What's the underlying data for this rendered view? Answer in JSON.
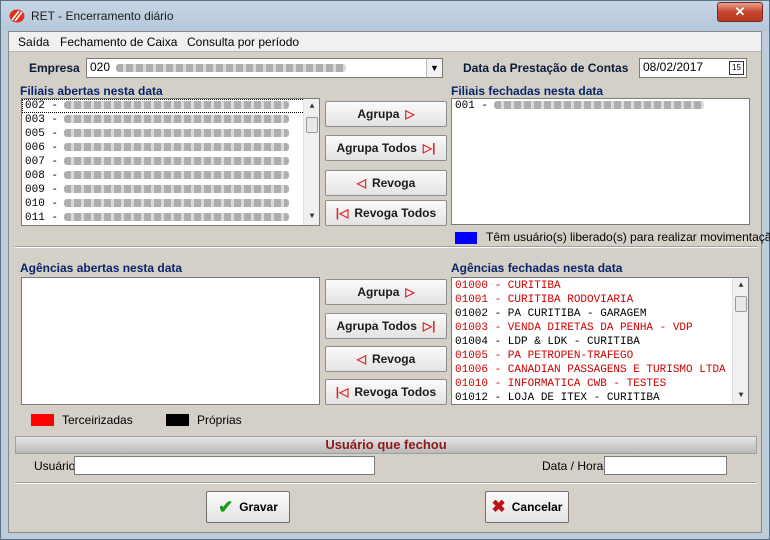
{
  "window": {
    "title": "RET - Encerramento diário",
    "close_label": "✕"
  },
  "menu": [
    "Saída",
    "Fechamento de Caixa",
    "Consulta por período"
  ],
  "empresa": {
    "label": "Empresa",
    "value": "020"
  },
  "data_prestacao": {
    "label": "Data da Prestação de Contas",
    "value": "08/02/2017",
    "icon": "calendar-icon"
  },
  "filiais_abertas": {
    "label": "Filiais abertas nesta data",
    "items": [
      "002 -",
      "003 -",
      "005 -",
      "006 -",
      "007 -",
      "008 -",
      "009 -",
      "010 -",
      "011 -"
    ]
  },
  "filiais_fechadas": {
    "label": "Filiais fechadas nesta data",
    "items": [
      "001 -"
    ]
  },
  "buttons_top": {
    "agrupa": "Agrupa",
    "agrupa_todos": "Agrupa Todos",
    "revoga": "Revoga",
    "revoga_todos": "Revoga Todos"
  },
  "legend_top": {
    "text": "Têm usuário(s) liberado(s) para realizar movimentação",
    "color": "#0000ff"
  },
  "agencias_abertas": {
    "label": "Agências abertas nesta data",
    "items": []
  },
  "agencias_fechadas": {
    "label": "Agências fechadas nesta data",
    "items": [
      {
        "text": "01000 - CURITIBA",
        "red": true
      },
      {
        "text": "01001 - CURITIBA RODOVIARIA",
        "red": true
      },
      {
        "text": "01002 - PA  CURITIBA - GARAGEM",
        "red": false
      },
      {
        "text": "01003 - VENDA DIRETAS DA PENHA - VDP",
        "red": true
      },
      {
        "text": "01004 - LDP & LDK - CURITIBA",
        "red": false
      },
      {
        "text": "01005 - PA PETROPEN-TRAFEGO",
        "red": true
      },
      {
        "text": "01006 - CANADIAN PASSAGENS E TURISMO LTDA",
        "red": true
      },
      {
        "text": "01010 - INFORMATICA CWB - TESTES",
        "red": true
      },
      {
        "text": "01012 - LOJA DE ITEX - CURITIBA",
        "red": false
      }
    ]
  },
  "buttons_bottom": {
    "agrupa": "Agrupa",
    "agrupa_todos": "Agrupa Todos",
    "revoga": "Revoga",
    "revoga_todos": "Revoga Todos"
  },
  "legend_bottom": [
    {
      "text": "Terceirizadas",
      "color": "#ff0000"
    },
    {
      "text": "Próprias",
      "color": "#000000"
    }
  ],
  "usuario_section": {
    "header": "Usuário que fechou",
    "usuario_label": "Usuário",
    "usuario_value": "",
    "datahora_label": "Data / Hora",
    "datahora_value": ""
  },
  "footer": {
    "gravar": "Gravar",
    "cancelar": "Cancelar"
  }
}
